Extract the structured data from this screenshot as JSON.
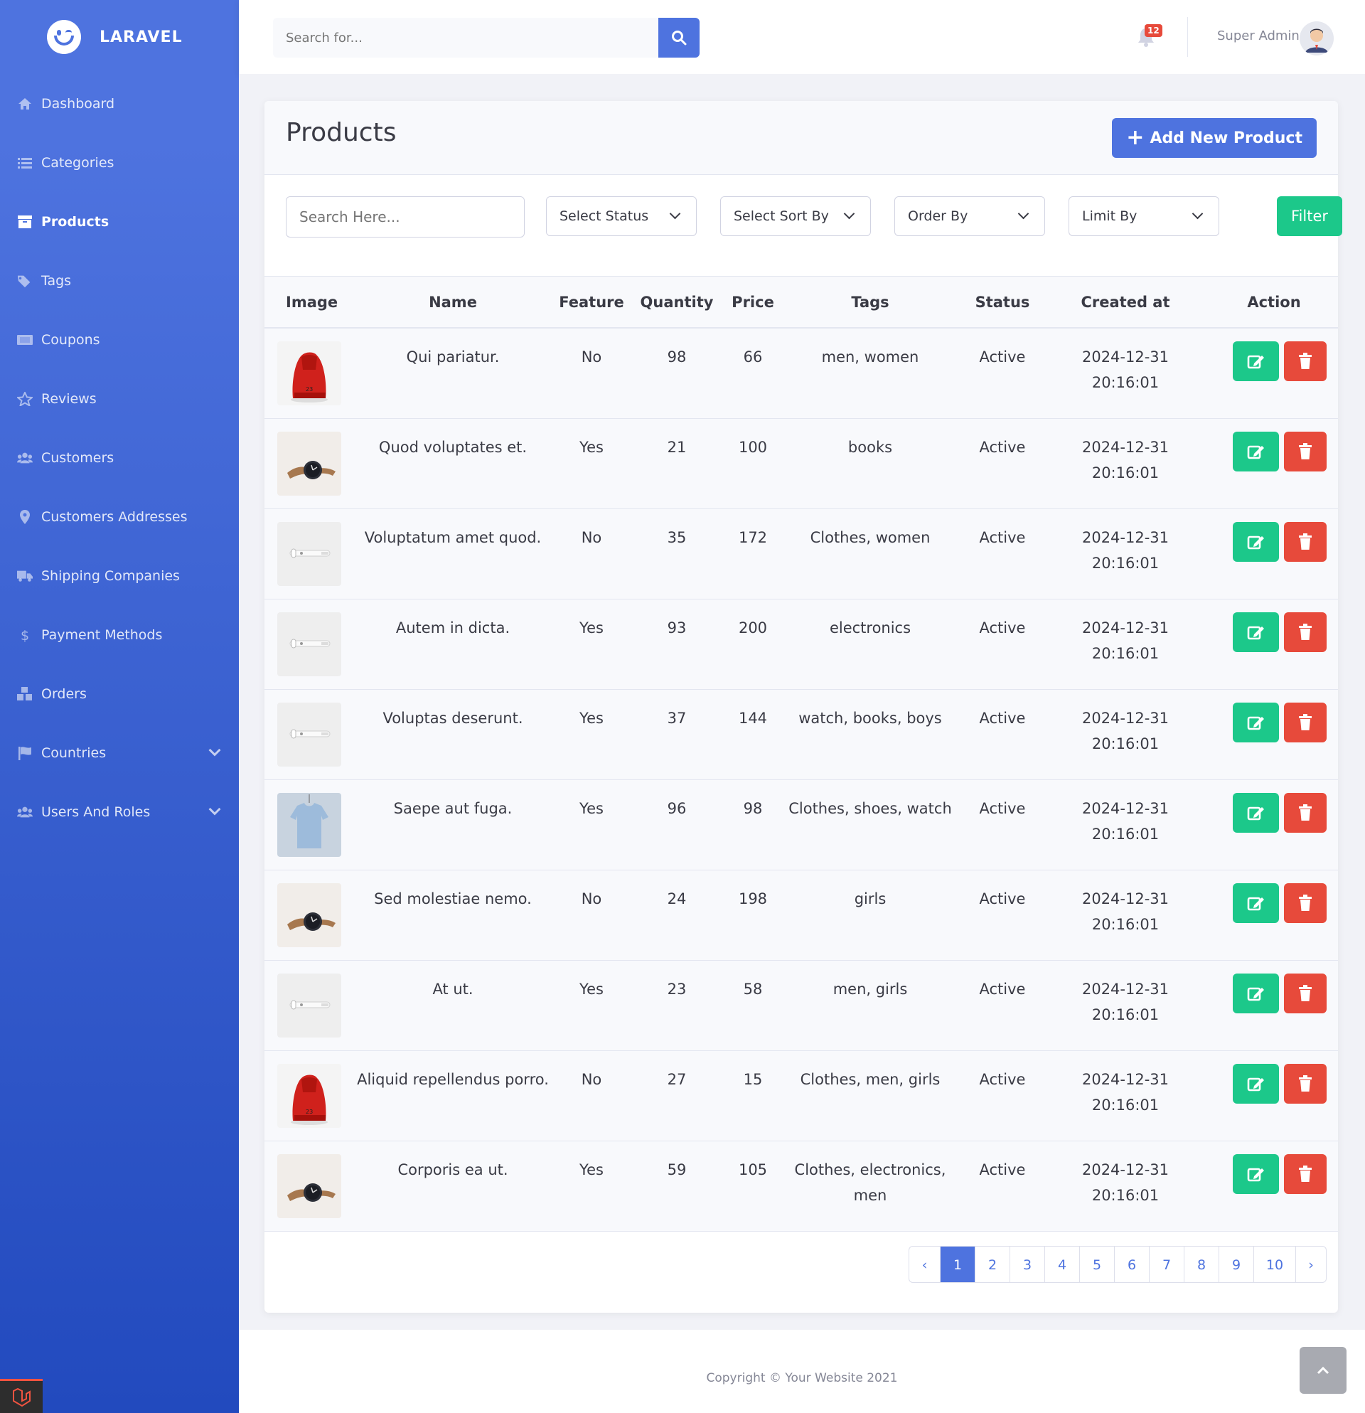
{
  "brand": {
    "name": "LARAVEL"
  },
  "sidebar": {
    "items": [
      {
        "label": "Dashboard",
        "icon": "home-icon"
      },
      {
        "label": "Categories",
        "icon": "list-icon"
      },
      {
        "label": "Products",
        "icon": "box-icon",
        "active": true
      },
      {
        "label": "Tags",
        "icon": "tags-icon"
      },
      {
        "label": "Coupons",
        "icon": "ticket-icon"
      },
      {
        "label": "Reviews",
        "icon": "star-icon"
      },
      {
        "label": "Customers",
        "icon": "users-icon"
      },
      {
        "label": "Customers Addresses",
        "icon": "map-marker-icon"
      },
      {
        "label": "Shipping Companies",
        "icon": "truck-icon"
      },
      {
        "label": "Payment Methods",
        "icon": "dollar-icon"
      },
      {
        "label": "Orders",
        "icon": "cubes-icon"
      },
      {
        "label": "Countries",
        "icon": "flag-icon",
        "expandable": true
      },
      {
        "label": "Users And Roles",
        "icon": "users-cog-icon",
        "expandable": true
      }
    ]
  },
  "topbar": {
    "search_placeholder": "Search for...",
    "notifications_count": "12",
    "user_name": "Super Admin"
  },
  "page": {
    "title": "Products",
    "add_button_label": "Add New Product"
  },
  "filters": {
    "search_placeholder": "Search Here...",
    "status": "Select Status",
    "sort_by": "Select Sort By",
    "order_by": "Order By",
    "limit_by": "Limit By",
    "filter_label": "Filter"
  },
  "table": {
    "headers": [
      "Image",
      "Name",
      "Feature",
      "Quantity",
      "Price",
      "Tags",
      "Status",
      "Created at",
      "Action"
    ],
    "rows": [
      {
        "image": "red-shoe",
        "name": "Qui pariatur.",
        "feature": "No",
        "quantity": "98",
        "price": "66",
        "tags": "men, women",
        "status": "Active",
        "date": "2024-12-31",
        "time": "20:16:01"
      },
      {
        "image": "watch",
        "name": "Quod voluptates et.",
        "feature": "Yes",
        "quantity": "21",
        "price": "100",
        "tags": "books",
        "status": "Active",
        "date": "2024-12-31",
        "time": "20:16:01"
      },
      {
        "image": "earbuds",
        "name": "Voluptatum amet quod.",
        "feature": "No",
        "quantity": "35",
        "price": "172",
        "tags": "Clothes, women",
        "status": "Active",
        "date": "2024-12-31",
        "time": "20:16:01"
      },
      {
        "image": "earbuds",
        "name": "Autem in dicta.",
        "feature": "Yes",
        "quantity": "93",
        "price": "200",
        "tags": "electronics",
        "status": "Active",
        "date": "2024-12-31",
        "time": "20:16:01"
      },
      {
        "image": "earbuds",
        "name": "Voluptas deserunt.",
        "feature": "Yes",
        "quantity": "37",
        "price": "144",
        "tags": "watch, books, boys",
        "status": "Active",
        "date": "2024-12-31",
        "time": "20:16:01"
      },
      {
        "image": "tshirt",
        "name": "Saepe aut fuga.",
        "feature": "Yes",
        "quantity": "96",
        "price": "98",
        "tags": "Clothes, shoes, watch",
        "status": "Active",
        "date": "2024-12-31",
        "time": "20:16:01"
      },
      {
        "image": "watch",
        "name": "Sed molestiae nemo.",
        "feature": "No",
        "quantity": "24",
        "price": "198",
        "tags": "girls",
        "status": "Active",
        "date": "2024-12-31",
        "time": "20:16:01"
      },
      {
        "image": "earbuds",
        "name": "At ut.",
        "feature": "Yes",
        "quantity": "23",
        "price": "58",
        "tags": "men, girls",
        "status": "Active",
        "date": "2024-12-31",
        "time": "20:16:01"
      },
      {
        "image": "red-shoe",
        "name": "Aliquid repellendus porro.",
        "feature": "No",
        "quantity": "27",
        "price": "15",
        "tags": "Clothes, men, girls",
        "status": "Active",
        "date": "2024-12-31",
        "time": "20:16:01"
      },
      {
        "image": "watch",
        "name": "Corporis ea ut.",
        "feature": "Yes",
        "quantity": "59",
        "price": "105",
        "tags": "Clothes, electronics, men",
        "status": "Active",
        "date": "2024-12-31",
        "time": "20:16:01"
      }
    ]
  },
  "pagination": {
    "prev": "‹",
    "next": "›",
    "pages": [
      "1",
      "2",
      "3",
      "4",
      "5",
      "6",
      "7",
      "8",
      "9",
      "10"
    ],
    "current": "1"
  },
  "footer": {
    "copyright": "Copyright © Your Website 2021"
  },
  "colors": {
    "primary": "#4e73df",
    "success": "#1cc88a",
    "danger": "#e74a3b"
  }
}
